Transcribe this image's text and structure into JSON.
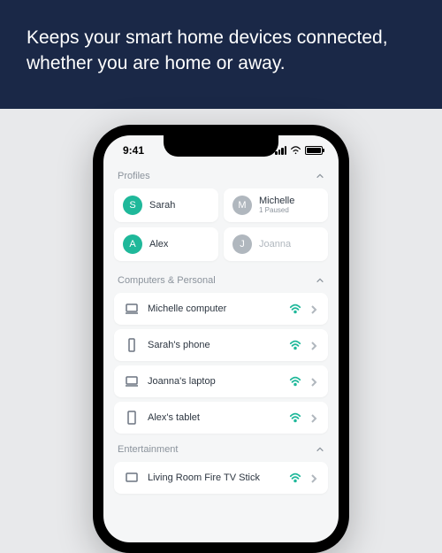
{
  "hero": {
    "text": "Keeps your smart home devices connected, whether you are home or away."
  },
  "statusBar": {
    "time": "9:41"
  },
  "sections": {
    "profiles": {
      "title": "Profiles",
      "items": [
        {
          "initial": "S",
          "name": "Sarah",
          "color": "green"
        },
        {
          "initial": "M",
          "name": "Michelle",
          "sub": "1 Paused",
          "color": "gray"
        },
        {
          "initial": "A",
          "name": "Alex",
          "color": "green"
        },
        {
          "initial": "J",
          "name": "Joanna",
          "color": "gray",
          "muted": true
        }
      ]
    },
    "computers": {
      "title": "Computers & Personal",
      "items": [
        {
          "name": "Michelle computer",
          "icon": "laptop"
        },
        {
          "name": "Sarah's phone",
          "icon": "phone"
        },
        {
          "name": "Joanna's laptop",
          "icon": "laptop"
        },
        {
          "name": "Alex's tablet",
          "icon": "tablet"
        }
      ]
    },
    "entertainment": {
      "title": "Entertainment",
      "items": [
        {
          "name": "Living Room Fire TV Stick",
          "icon": "tv"
        }
      ]
    }
  }
}
